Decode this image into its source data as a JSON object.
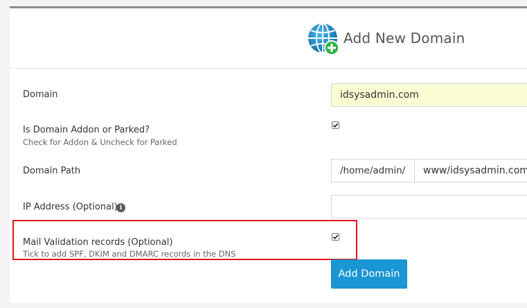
{
  "header": {
    "title": "Add New Domain",
    "icon": "globe-add-icon"
  },
  "form": {
    "domain": {
      "label": "Domain",
      "value": "idsysadmin.com"
    },
    "addon_or_parked": {
      "label": "Is Domain Addon or Parked?",
      "hint": "Check for Addon & Uncheck for Parked",
      "checked": true
    },
    "domain_path": {
      "label": "Domain Path",
      "prefix": "/home/admin/",
      "value": "www/idsysadmin.com"
    },
    "ip_address": {
      "label": "IP Address (Optional)",
      "value": "",
      "icon": "info-icon"
    },
    "mail_validation": {
      "label": "Mail Validation records (Optional)",
      "hint": "Tick to add SPF, DKIM and DMARC records in the DNS",
      "checked": true
    },
    "submit_label": "Add Domain"
  },
  "colors": {
    "accent": "#1a96d4",
    "highlight_border": "#e0151a",
    "filled_input_bg": "#fafcd2"
  }
}
